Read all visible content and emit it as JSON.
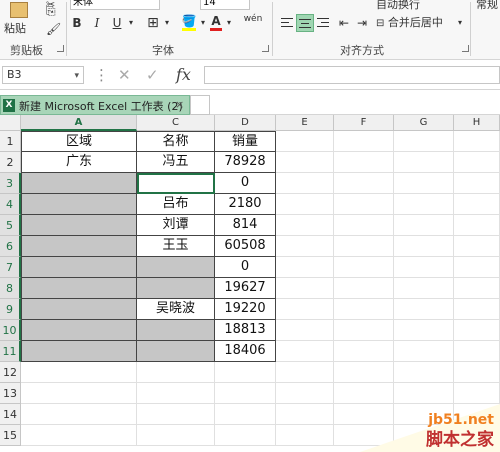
{
  "ribbon": {
    "paste_label": "粘贴",
    "font_name": "宋体",
    "font_size": "14",
    "bold": "B",
    "italic": "I",
    "underline": "U",
    "font_color_glyph": "A",
    "wen_glyph": "wén",
    "wrap_text_label": "自动换行",
    "merge_center_label": "合并后居中",
    "number_format": "常规",
    "groups": {
      "clipboard": "剪贴板",
      "font": "字体",
      "alignment": "对齐方式"
    }
  },
  "formula_bar": {
    "name_box": "B3",
    "cancel_glyph": "✕",
    "enter_glyph": "✓",
    "fx_label": "fx",
    "formula": ""
  },
  "tab": {
    "title": "新建 Microsoft Excel 工作表 (2)",
    "icon_text": "X",
    "close_glyph": "×"
  },
  "sheet": {
    "columns": [
      "A",
      "C",
      "D",
      "E",
      "F",
      "G",
      "H"
    ],
    "rows": [
      "1",
      "2",
      "3",
      "4",
      "5",
      "6",
      "7",
      "8",
      "9",
      "10",
      "11",
      "12",
      "13",
      "14",
      "15"
    ],
    "headers": {
      "a": "区域",
      "c": "名称",
      "d": "销量"
    },
    "data": [
      {
        "a": "广东",
        "c": "冯五",
        "d": "78928"
      },
      {
        "a": "",
        "c": "",
        "d": "0"
      },
      {
        "a": "",
        "c": "吕布",
        "d": "2180"
      },
      {
        "a": "",
        "c": "刘谭",
        "d": "814"
      },
      {
        "a": "",
        "c": "王玉",
        "d": "60508"
      },
      {
        "a": "",
        "c": "",
        "d": "0"
      },
      {
        "a": "",
        "c": "",
        "d": "19627"
      },
      {
        "a": "",
        "c": "吴晓波",
        "d": "19220"
      },
      {
        "a": "",
        "c": "",
        "d": "18813"
      },
      {
        "a": "",
        "c": "",
        "d": "18406"
      }
    ]
  },
  "watermark": {
    "site": "jb51.net",
    "name": "脚本之家"
  },
  "colors": {
    "excel_green": "#217346",
    "selection_gray": "#c6c6c6",
    "tab_green": "#a8d5b8"
  }
}
